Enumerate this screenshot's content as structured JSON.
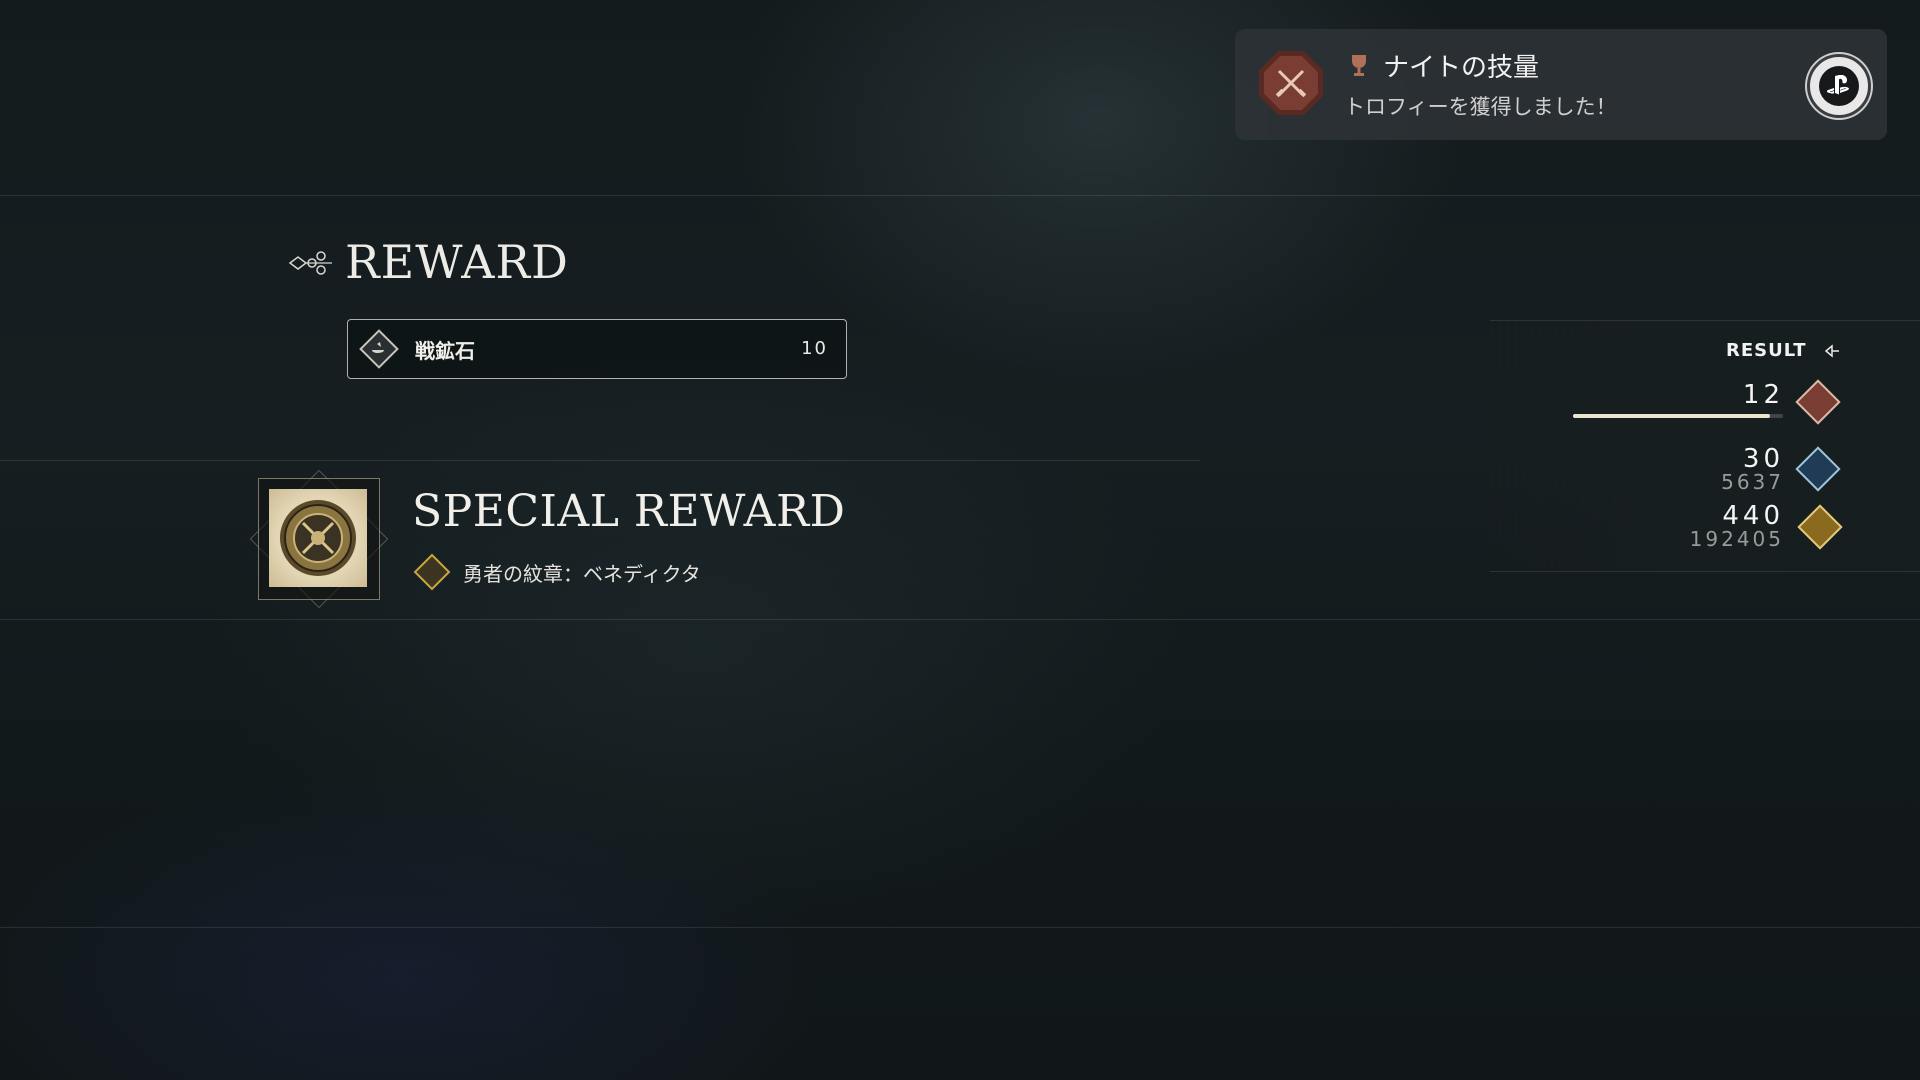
{
  "trophy_notification": {
    "title": "ナイトの技量",
    "subtitle": "トロフィーを獲得しました！"
  },
  "reward": {
    "title": "REWARD",
    "items": [
      {
        "name": "戦鉱石",
        "quantity": "10"
      }
    ]
  },
  "special_reward": {
    "title": "SPECIAL REWARD",
    "item_name": "勇者の紋章：ベネディクタ"
  },
  "result": {
    "label": "RESULT",
    "level": {
      "value": "12",
      "progress": 0.94
    },
    "stat_blue": {
      "value": "30",
      "total": "5637"
    },
    "stat_gold": {
      "value": "440",
      "total": "192405"
    }
  },
  "colors": {
    "trophy_bronze": "#7a3d33",
    "accent_gold": "#c9a640",
    "accent_blue": "#3a8fc7",
    "text_light": "#f2f2f2"
  },
  "icons": {
    "trophy": "trophy-cup-icon",
    "ps": "playstation-icon",
    "item": "ore-icon",
    "special_item": "emblem-icon"
  }
}
